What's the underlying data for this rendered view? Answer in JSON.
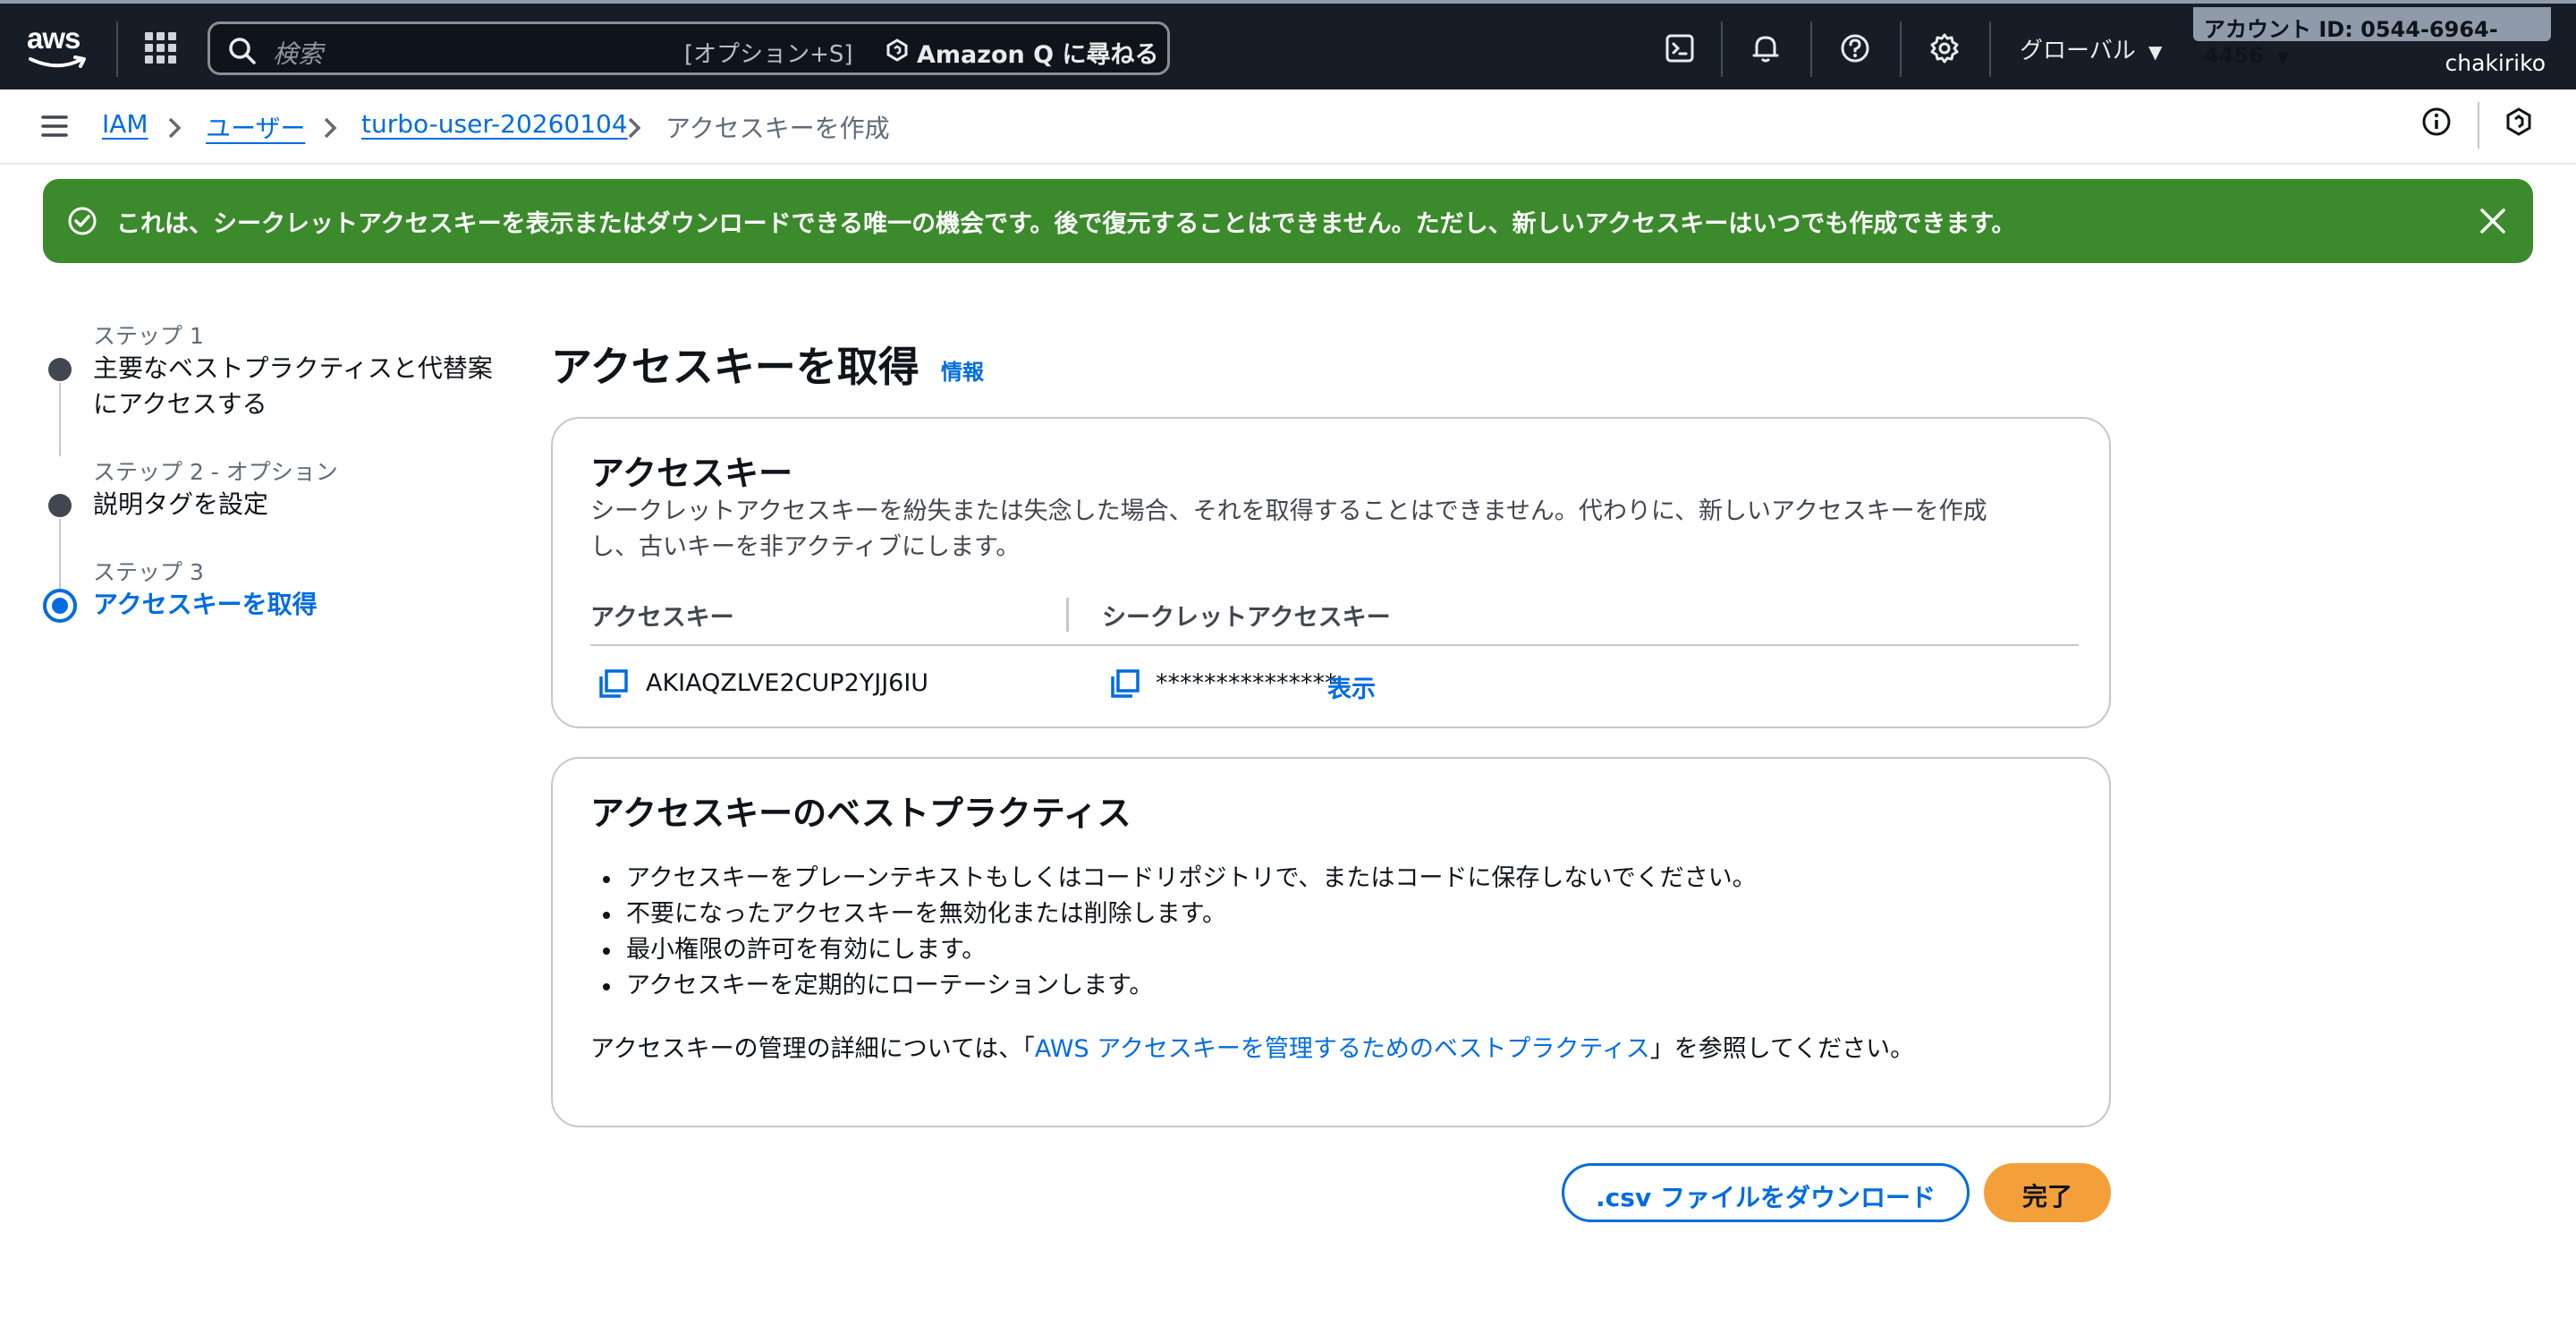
{
  "topnav": {
    "logo_text": "aws",
    "search_placeholder": "検索",
    "search_shortcut": "[オプション+S]",
    "ask_q": "Amazon Q に尋ねる",
    "region": "グローバル",
    "account_id": "アカウント ID: 0544-6964-4456",
    "username": "chakiriko"
  },
  "breadcrumb": {
    "items": [
      "IAM",
      "ユーザー",
      "turbo-user-20260104"
    ],
    "current": "アクセスキーを作成"
  },
  "flash": {
    "message": "これは、シークレットアクセスキーを表示またはダウンロードできる唯一の機会です。後で復元することはできません。ただし、新しいアクセスキーはいつでも作成できます。"
  },
  "steps": [
    {
      "label": "ステップ 1",
      "title_line1": "主要なベストプラクティスと代替案",
      "title_line2": "にアクセスする"
    },
    {
      "label": "ステップ 2 - オプション",
      "title": "説明タグを設定"
    },
    {
      "label": "ステップ 3",
      "title": "アクセスキーを取得"
    }
  ],
  "main": {
    "title": "アクセスキーを取得",
    "info": "情報"
  },
  "access_key_card": {
    "heading": "アクセスキー",
    "desc_line1": "シークレットアクセスキーを紛失または失念した場合、それを取得することはできません。代わりに、新しいアクセスキーを作成",
    "desc_line2": "し、古いキーを非アクティブにします。",
    "col_access_key": "アクセスキー",
    "col_secret": "シークレットアクセスキー",
    "access_key_value": "AKIAQZLVE2CUP2YJJ6IU",
    "secret_masked": "***************",
    "show": "表示"
  },
  "best_practices_card": {
    "heading": "アクセスキーのベストプラクティス",
    "items": [
      "アクセスキーをプレーンテキストもしくはコードリポジトリで、またはコードに保存しないでください。",
      "不要になったアクセスキーを無効化または削除します。",
      "最小権限の許可を有効にします。",
      "アクセスキーを定期的にローテーションします。"
    ],
    "footer_prefix": "アクセスキーの管理の詳細については、「",
    "footer_link": "AWS アクセスキーを管理するためのベストプラクティス",
    "footer_suffix": "」を参照してください。"
  },
  "buttons": {
    "download_csv": ".csv ファイルをダウンロード",
    "done": "完了"
  },
  "colors": {
    "nav_bg": "#161d26",
    "link": "#006ce0",
    "success": "#3b8a2c",
    "primary_button": "#f4a03a"
  }
}
